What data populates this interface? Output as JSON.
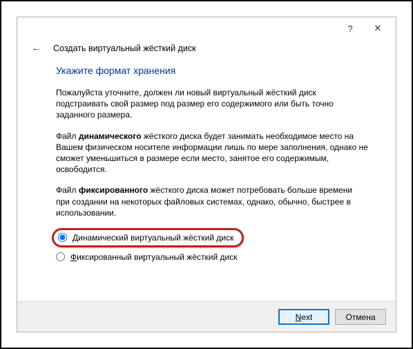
{
  "titlebar": {
    "help_glyph": "?",
    "close_glyph": "✕"
  },
  "header": {
    "back_glyph": "←",
    "title": "Создать виртуальный жёсткий диск"
  },
  "content": {
    "section_title": "Укажите формат хранения",
    "para1": "Пожалуйста уточните, должен ли новый виртуальный жёсткий диск подстраивать свой размер под размер его содержимого или быть точно заданного размера.",
    "para2_pre": "Файл ",
    "para2_bold": "динамического",
    "para2_post": " жёсткого диска будет занимать необходимое место на Вашем физическом носителе информации лишь по мере заполнения, однако не сможет уменьшиться в размере если место, занятое его содержимым, освободится.",
    "para3_pre": "Файл ",
    "para3_bold": "фиксированного",
    "para3_post": " жёсткого диска может потребовать больше времени при создании на некоторых файловых системах, однако, обычно, быстрее в использовании."
  },
  "radios": {
    "dynamic": {
      "mnemonic": "Д",
      "rest": "инамический виртуальный жёсткий диск",
      "checked": true
    },
    "fixed": {
      "mnemonic": "Ф",
      "rest": "иксированный виртуальный жёсткий диск",
      "checked": false
    }
  },
  "footer": {
    "next_mnemonic": "N",
    "next_rest": "ext",
    "cancel": "Отмена"
  }
}
